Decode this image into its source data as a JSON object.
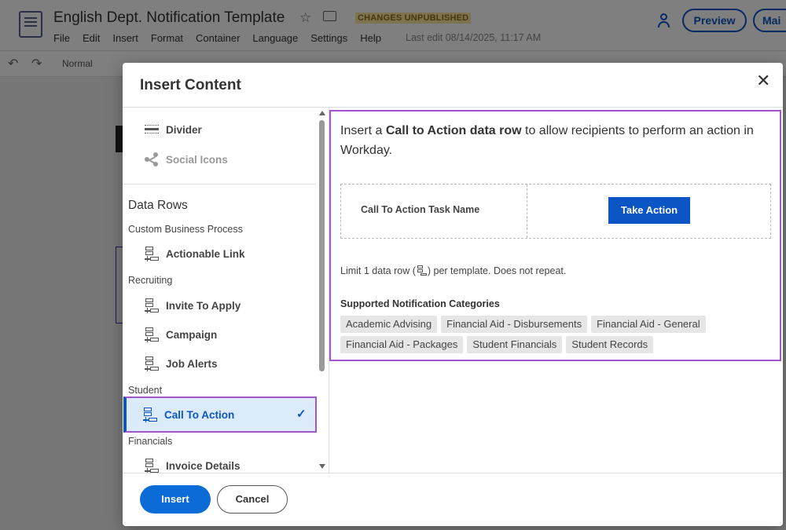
{
  "app": {
    "title": "English Dept. Notification Template",
    "status_badge": "CHANGES UNPUBLISHED",
    "menu": [
      "File",
      "Edit",
      "Insert",
      "Format",
      "Container",
      "Language",
      "Settings",
      "Help"
    ],
    "last_edit": "Last edit 08/14/2025, 11:17 AM",
    "preview_label": "Preview",
    "main_label": "Mai",
    "toolbar_style": "Normal"
  },
  "modal": {
    "title": "Insert Content",
    "close_glyph": "✕",
    "left": {
      "items_top": [
        {
          "label": "Divider",
          "icon": "divider-icon"
        },
        {
          "label": "Social Icons",
          "icon": "share-icon",
          "disabled": true
        }
      ],
      "section_heading": "Data Rows",
      "groups": [
        {
          "heading": "Custom Business Process",
          "items": [
            {
              "label": "Actionable Link"
            }
          ]
        },
        {
          "heading": "Recruiting",
          "items": [
            {
              "label": "Invite To Apply"
            },
            {
              "label": "Campaign"
            },
            {
              "label": "Job Alerts"
            }
          ]
        },
        {
          "heading": "Student",
          "items": [
            {
              "label": "Call To Action",
              "selected": true
            }
          ]
        },
        {
          "heading": "Financials",
          "items": [
            {
              "label": "Invoice Details"
            }
          ]
        }
      ],
      "check_glyph": "✓"
    },
    "preview": {
      "desc_prefix": "Insert a ",
      "desc_bold": "Call to Action data row",
      "desc_suffix": " to allow recipients to perform an action in Workday.",
      "sample_task_name": "Call To Action Task Name",
      "sample_button": "Take Action",
      "limit_prefix": "Limit 1 data row (",
      "limit_suffix": ") per template. Does not repeat.",
      "categories_heading": "Supported Notification Categories",
      "categories": [
        "Academic Advising",
        "Financial Aid - Disbursements",
        "Financial Aid - General",
        "Financial Aid - Packages",
        "Student Financials",
        "Student Records"
      ]
    },
    "footer": {
      "insert_label": "Insert",
      "cancel_label": "Cancel"
    }
  },
  "colors": {
    "accent": "#0b55c4",
    "primary_button": "#0b6cd8",
    "highlight_border": "#a355cf",
    "selected_bg": "#dcebf9"
  }
}
